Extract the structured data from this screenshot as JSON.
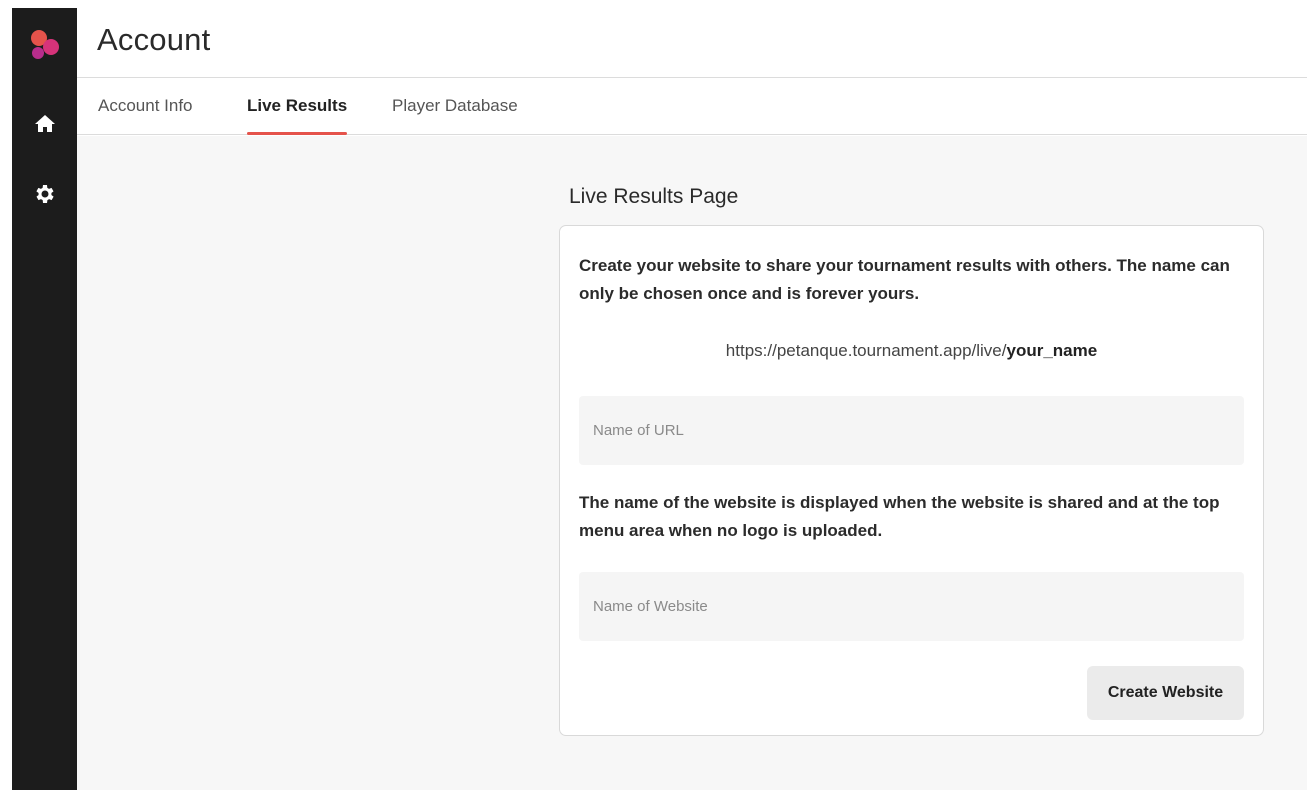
{
  "header": {
    "title": "Account"
  },
  "tabs": [
    {
      "label": "Account Info",
      "active": false
    },
    {
      "label": "Live Results",
      "active": true
    },
    {
      "label": "Player Database",
      "active": false
    }
  ],
  "sidebar": {
    "logo": "app-logo",
    "items": [
      {
        "icon": "home-icon"
      },
      {
        "icon": "gear-icon"
      }
    ]
  },
  "main": {
    "section_title": "Live Results Page",
    "intro_text": "Create your website to share your tournament results with others. The name can only be chosen once and is forever yours.",
    "url_prefix": "https://petanque.tournament.app/live/",
    "url_suffix": "your_name",
    "url_field": {
      "placeholder": "Name of URL",
      "value": ""
    },
    "website_note": "The name of the website is displayed when the website is shared and at the top menu area when no logo is uploaded.",
    "website_field": {
      "placeholder": "Name of Website",
      "value": ""
    },
    "create_button": "Create Website"
  },
  "colors": {
    "sidebar_bg": "#1c1c1c",
    "tab_indicator": "#e5534b",
    "logo_red": "#e5534b",
    "logo_pink": "#d6337a",
    "logo_magenta": "#b82d8c"
  }
}
